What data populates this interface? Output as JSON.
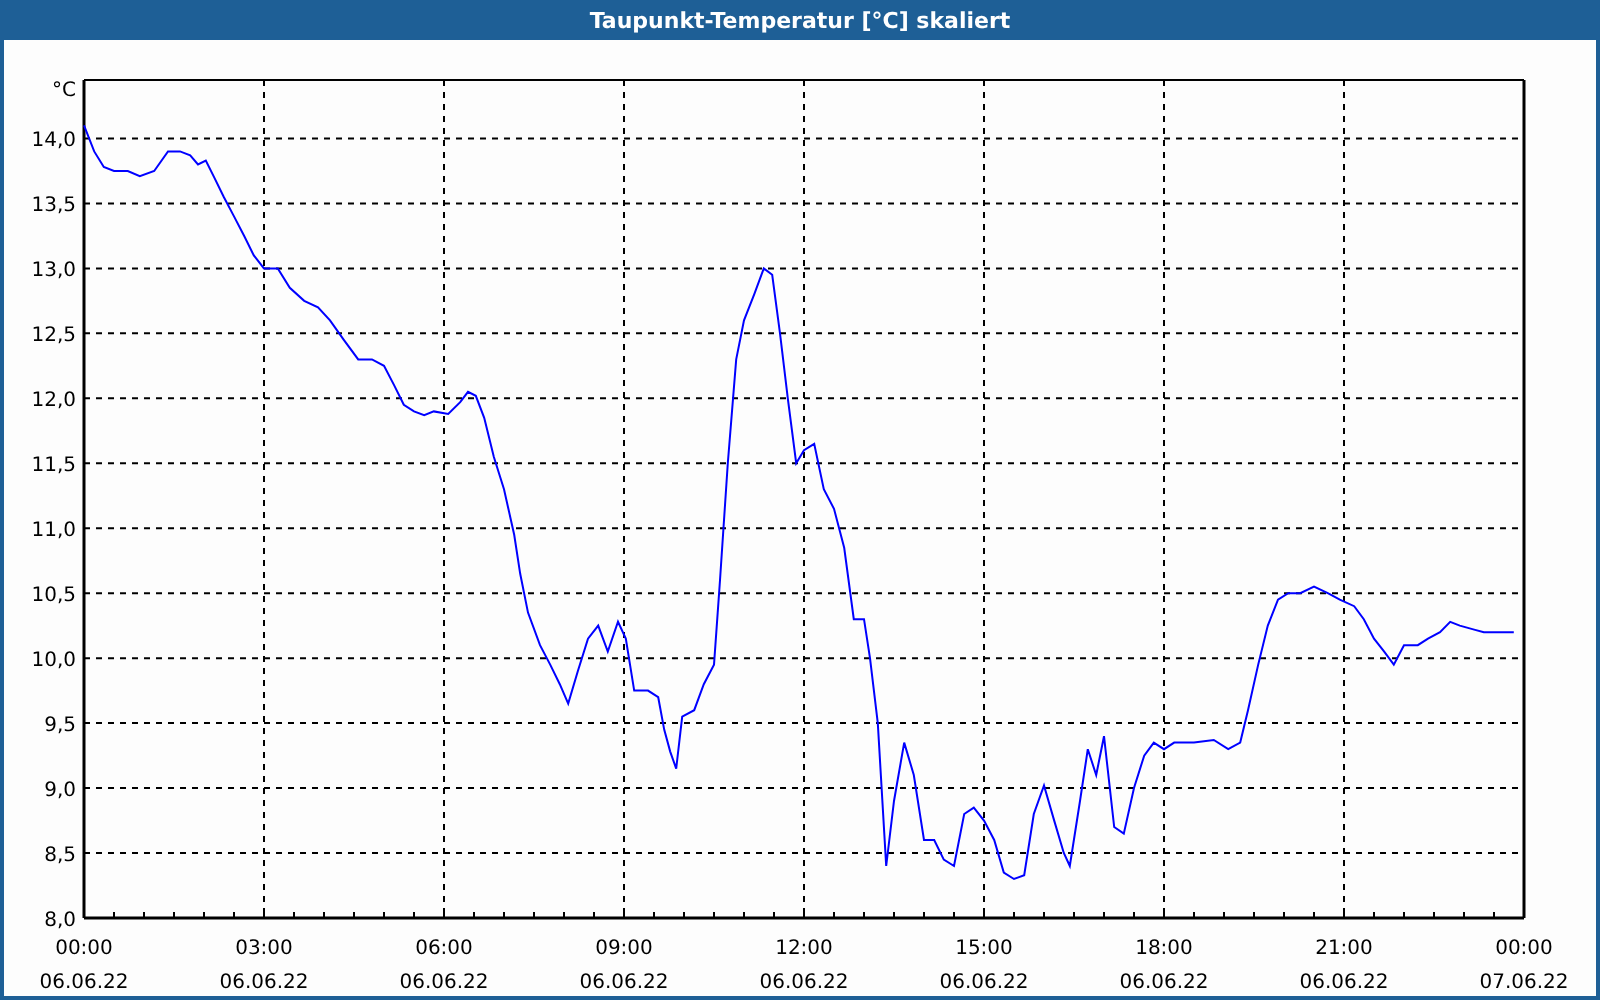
{
  "window": {
    "title": "Taupunkt-Temperatur [°C] skaliert"
  },
  "chart": {
    "x_tick_dates": [
      "06.06.22",
      "06.06.22",
      "06.06.22",
      "06.06.22",
      "06.06.22",
      "06.06.22",
      "06.06.22",
      "06.06.22",
      "07.06.22"
    ],
    "chart_data": {
      "type": "line",
      "grid": true,
      "ylabel": "°C",
      "xlim": [
        0,
        24
      ],
      "ylim": [
        8,
        14.45
      ],
      "xticks": [
        {
          "value": 0,
          "label": "00:00"
        },
        {
          "value": 3,
          "label": "03:00"
        },
        {
          "value": 6,
          "label": "06:00"
        },
        {
          "value": 9,
          "label": "09:00"
        },
        {
          "value": 12,
          "label": "12:00"
        },
        {
          "value": 15,
          "label": "15:00"
        },
        {
          "value": 18,
          "label": "18:00"
        },
        {
          "value": 21,
          "label": "21:00"
        },
        {
          "value": 24,
          "label": "00:00"
        }
      ],
      "yticks": [
        {
          "value": 8,
          "label": "8,0"
        },
        {
          "value": 8.5,
          "label": "8,5"
        },
        {
          "value": 9,
          "label": "9,0"
        },
        {
          "value": 9.5,
          "label": "9,5"
        },
        {
          "value": 10,
          "label": "10,0"
        },
        {
          "value": 10.5,
          "label": "10,5"
        },
        {
          "value": 11,
          "label": "11,0"
        },
        {
          "value": 11.5,
          "label": "11,5"
        },
        {
          "value": 12,
          "label": "12,0"
        },
        {
          "value": 12.5,
          "label": "12,5"
        },
        {
          "value": 13,
          "label": "13,0"
        },
        {
          "value": 13.5,
          "label": "13,5"
        },
        {
          "value": 14,
          "label": "14,0"
        }
      ],
      "x": [
        0,
        0.17,
        0.33,
        0.5,
        0.73,
        0.93,
        1.17,
        1.4,
        1.6,
        1.77,
        1.9,
        2.03,
        2.17,
        2.33,
        2.5,
        2.67,
        2.83,
        3,
        3.23,
        3.43,
        3.67,
        3.9,
        4.1,
        4.33,
        4.57,
        4.8,
        5,
        5.17,
        5.33,
        5.5,
        5.67,
        5.83,
        6.07,
        6.27,
        6.4,
        6.53,
        6.67,
        6.83,
        7,
        7.17,
        7.27,
        7.4,
        7.6,
        7.77,
        7.93,
        8.07,
        8.23,
        8.4,
        8.57,
        8.73,
        8.9,
        9.03,
        9.17,
        9.4,
        9.57,
        9.67,
        9.77,
        9.87,
        9.97,
        10.17,
        10.33,
        10.5,
        10.6,
        10.73,
        10.87,
        11,
        11.17,
        11.33,
        11.47,
        11.6,
        11.73,
        11.87,
        12,
        12.17,
        12.33,
        12.5,
        12.67,
        12.83,
        13,
        13.1,
        13.23,
        13.37,
        13.5,
        13.67,
        13.83,
        14,
        14.17,
        14.33,
        14.5,
        14.67,
        14.83,
        15,
        15.17,
        15.33,
        15.5,
        15.67,
        15.83,
        16,
        16.17,
        16.33,
        16.43,
        16.6,
        16.73,
        16.87,
        17,
        17.17,
        17.33,
        17.5,
        17.67,
        17.83,
        18,
        18.17,
        18.5,
        18.83,
        19.07,
        19.27,
        19.4,
        19.57,
        19.73,
        19.9,
        20.07,
        20.27,
        20.5,
        20.73,
        20.93,
        21.17,
        21.33,
        21.5,
        21.67,
        21.83,
        22,
        22.23,
        22.4,
        22.6,
        22.77,
        22.93,
        23.17,
        23.33,
        23.5,
        23.67,
        23.83
      ],
      "series": [
        {
          "color": "#0000ff",
          "values": [
            14.1,
            13.9,
            13.78,
            13.75,
            13.75,
            13.71,
            13.75,
            13.9,
            13.9,
            13.87,
            13.8,
            13.83,
            13.7,
            13.55,
            13.4,
            13.25,
            13.1,
            13.0,
            13.0,
            12.85,
            12.75,
            12.7,
            12.6,
            12.45,
            12.3,
            12.3,
            12.25,
            12.1,
            11.95,
            11.9,
            11.87,
            11.9,
            11.88,
            11.97,
            12.05,
            12.02,
            11.85,
            11.55,
            11.3,
            10.95,
            10.65,
            10.35,
            10.1,
            9.95,
            9.8,
            9.65,
            9.9,
            10.15,
            10.25,
            10.05,
            10.28,
            10.15,
            9.75,
            9.75,
            9.7,
            9.45,
            9.28,
            9.15,
            9.55,
            9.6,
            9.8,
            9.95,
            10.6,
            11.5,
            12.3,
            12.6,
            12.8,
            13.0,
            12.95,
            12.5,
            12.0,
            11.5,
            11.6,
            11.65,
            11.3,
            11.15,
            10.85,
            10.3,
            10.3,
            10.0,
            9.5,
            8.4,
            8.9,
            9.35,
            9.1,
            8.6,
            8.6,
            8.45,
            8.4,
            8.8,
            8.85,
            8.75,
            8.6,
            8.35,
            8.3,
            8.33,
            8.8,
            9.02,
            8.75,
            8.5,
            8.4,
            8.9,
            9.3,
            9.1,
            9.4,
            8.7,
            8.65,
            9.0,
            9.25,
            9.35,
            9.3,
            9.35,
            9.35,
            9.37,
            9.3,
            9.35,
            9.6,
            9.95,
            10.25,
            10.45,
            10.5,
            10.5,
            10.55,
            10.5,
            10.45,
            10.4,
            10.3,
            10.15,
            10.05,
            9.95,
            10.1,
            10.1,
            10.15,
            10.2,
            10.28,
            10.25,
            10.22,
            10.2,
            10.2,
            10.2,
            10.2
          ]
        }
      ]
    }
  }
}
